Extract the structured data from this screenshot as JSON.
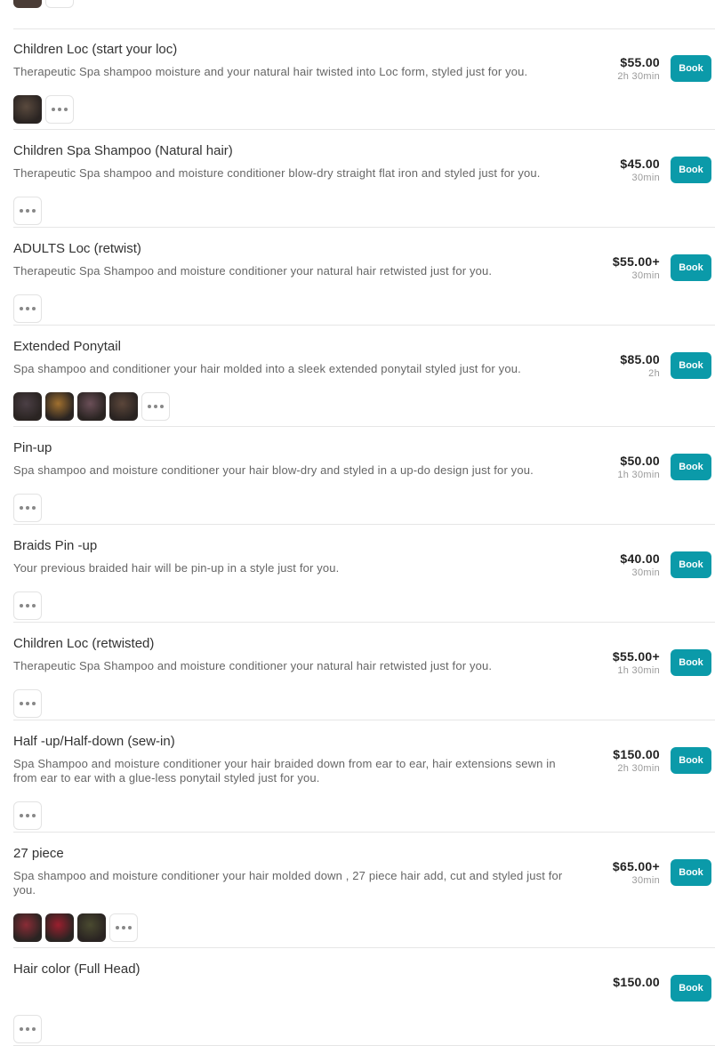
{
  "colors": {
    "accent": "#0b9aa9",
    "divider": "#e6e6e6"
  },
  "more_icon": "ellipsis-icon",
  "services": [
    {
      "name": "Children Loc (start your loc)",
      "description": "Therapeutic Spa shampoo moisture and your natural hair twisted into Loc form, styled just for you.",
      "price": "$55.00",
      "duration": "2h 30min",
      "book_label": "Book",
      "photos": [
        "#5a4a3e"
      ]
    },
    {
      "name": "Children Spa Shampoo (Natural hair)",
      "description": "Therapeutic Spa shampoo and moisture conditioner blow-dry straight flat iron and styled just for you.",
      "price": "$45.00",
      "duration": "30min",
      "book_label": "Book",
      "photos": []
    },
    {
      "name": "ADULTS Loc (retwist)",
      "description": "Therapeutic Spa Shampoo and moisture conditioner your natural hair retwisted just for you.",
      "price": "$55.00+",
      "duration": "30min",
      "book_label": "Book",
      "photos": []
    },
    {
      "name": "Extended Ponytail",
      "description": "Spa shampoo and conditioner your hair molded into a sleek extended ponytail styled just for you.",
      "price": "$85.00",
      "duration": "2h",
      "book_label": "Book",
      "photos": [
        "#4b3f45",
        "#a0702f",
        "#6b4f58",
        "#5b463a"
      ]
    },
    {
      "name": "Pin-up",
      "description": "Spa shampoo and moisture conditioner your hair blow-dry and styled in a up-do design just for you.",
      "price": "$50.00",
      "duration": "1h 30min",
      "book_label": "Book",
      "photos": []
    },
    {
      "name": "Braids Pin -up",
      "description": "Your previous braided hair will be pin-up in a style just for you.",
      "price": "$40.00",
      "duration": "30min",
      "book_label": "Book",
      "photos": []
    },
    {
      "name": "Children Loc (retwisted)",
      "description": "Therapeutic Spa Shampoo and moisture conditioner your natural hair retwisted just for you.",
      "price": "$55.00+",
      "duration": "1h 30min",
      "book_label": "Book",
      "photos": []
    },
    {
      "name": "Half -up/Half-down (sew-in)",
      "description": "Spa Shampoo and moisture conditioner your hair braided down from ear to ear, hair extensions sewn in from ear to ear with a glue-less ponytail styled just for you.",
      "price": "$150.00",
      "duration": "2h 30min",
      "book_label": "Book",
      "photos": []
    },
    {
      "name": "27 piece",
      "description": "Spa shampoo and moisture conditioner your hair molded down , 27 piece hair add, cut and styled just for you.",
      "price": "$65.00+",
      "duration": "30min",
      "book_label": "Book",
      "photos": [
        "#8a2c36",
        "#9a1f2e",
        "#4a4a30"
      ]
    },
    {
      "name": "Hair color (Full Head)",
      "description": "",
      "price": "$150.00",
      "duration": "",
      "book_label": "Book",
      "photos": []
    }
  ]
}
